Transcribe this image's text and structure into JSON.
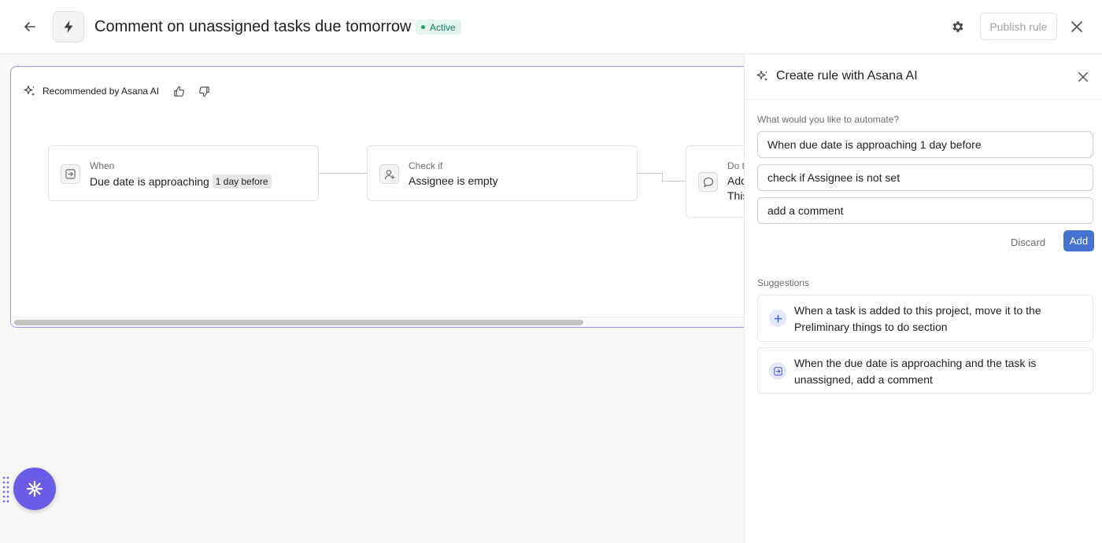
{
  "header": {
    "title": "Comment on unassigned tasks due tomorrow",
    "status": "Active",
    "publish_label": "Publish rule"
  },
  "canvas": {
    "recommended_label": "Recommended by Asana AI",
    "nodes": [
      {
        "label": "When",
        "value": "Due date is approaching",
        "chip": "1 day before"
      },
      {
        "label": "Check if",
        "value": "Assignee is empty"
      },
      {
        "label": "Do t",
        "value": "Add",
        "value2": "This"
      }
    ]
  },
  "panel": {
    "title": "Create rule with Asana AI",
    "question": "What would you like to automate?",
    "inputs": [
      "When due date is approaching 1 day before",
      "check if Assignee is not set",
      "add a comment"
    ],
    "discard_label": "Discard",
    "add_label": "Add",
    "suggestions_label": "Suggestions",
    "suggestions": [
      {
        "text": "When a task is added to this project, move it to the Preliminary things to do section",
        "icon": "plus-icon"
      },
      {
        "text": "When the due date is approaching and the task is unassigned, add a comment",
        "icon": "due-date-icon"
      }
    ]
  },
  "colors": {
    "accent": "#4573d2",
    "active_badge_bg": "#e4f5ee",
    "active_badge_text": "#0d7f56",
    "fab": "#6b5ce7",
    "canvas_border": "#9f97e6"
  }
}
